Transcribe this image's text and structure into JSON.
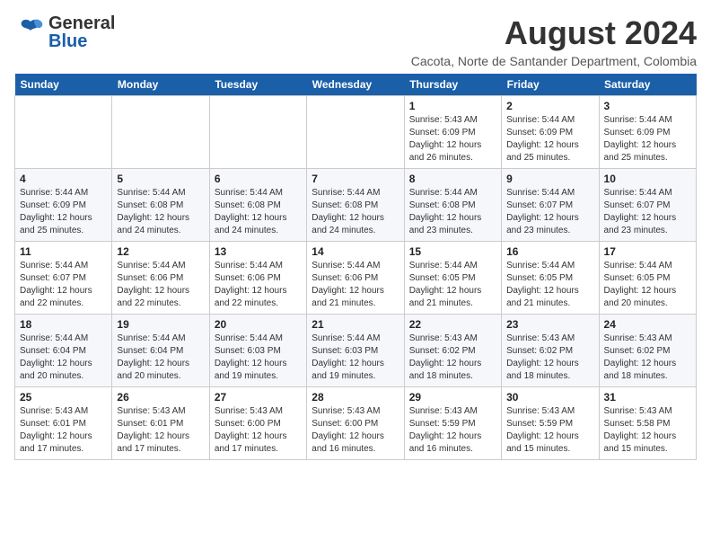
{
  "header": {
    "logo_general": "General",
    "logo_blue": "Blue",
    "month": "August 2024",
    "location": "Cacota, Norte de Santander Department, Colombia"
  },
  "weekdays": [
    "Sunday",
    "Monday",
    "Tuesday",
    "Wednesday",
    "Thursday",
    "Friday",
    "Saturday"
  ],
  "weeks": [
    [
      {
        "day": "",
        "info": ""
      },
      {
        "day": "",
        "info": ""
      },
      {
        "day": "",
        "info": ""
      },
      {
        "day": "",
        "info": ""
      },
      {
        "day": "1",
        "info": "Sunrise: 5:43 AM\nSunset: 6:09 PM\nDaylight: 12 hours\nand 26 minutes."
      },
      {
        "day": "2",
        "info": "Sunrise: 5:44 AM\nSunset: 6:09 PM\nDaylight: 12 hours\nand 25 minutes."
      },
      {
        "day": "3",
        "info": "Sunrise: 5:44 AM\nSunset: 6:09 PM\nDaylight: 12 hours\nand 25 minutes."
      }
    ],
    [
      {
        "day": "4",
        "info": "Sunrise: 5:44 AM\nSunset: 6:09 PM\nDaylight: 12 hours\nand 25 minutes."
      },
      {
        "day": "5",
        "info": "Sunrise: 5:44 AM\nSunset: 6:08 PM\nDaylight: 12 hours\nand 24 minutes."
      },
      {
        "day": "6",
        "info": "Sunrise: 5:44 AM\nSunset: 6:08 PM\nDaylight: 12 hours\nand 24 minutes."
      },
      {
        "day": "7",
        "info": "Sunrise: 5:44 AM\nSunset: 6:08 PM\nDaylight: 12 hours\nand 24 minutes."
      },
      {
        "day": "8",
        "info": "Sunrise: 5:44 AM\nSunset: 6:08 PM\nDaylight: 12 hours\nand 23 minutes."
      },
      {
        "day": "9",
        "info": "Sunrise: 5:44 AM\nSunset: 6:07 PM\nDaylight: 12 hours\nand 23 minutes."
      },
      {
        "day": "10",
        "info": "Sunrise: 5:44 AM\nSunset: 6:07 PM\nDaylight: 12 hours\nand 23 minutes."
      }
    ],
    [
      {
        "day": "11",
        "info": "Sunrise: 5:44 AM\nSunset: 6:07 PM\nDaylight: 12 hours\nand 22 minutes."
      },
      {
        "day": "12",
        "info": "Sunrise: 5:44 AM\nSunset: 6:06 PM\nDaylight: 12 hours\nand 22 minutes."
      },
      {
        "day": "13",
        "info": "Sunrise: 5:44 AM\nSunset: 6:06 PM\nDaylight: 12 hours\nand 22 minutes."
      },
      {
        "day": "14",
        "info": "Sunrise: 5:44 AM\nSunset: 6:06 PM\nDaylight: 12 hours\nand 21 minutes."
      },
      {
        "day": "15",
        "info": "Sunrise: 5:44 AM\nSunset: 6:05 PM\nDaylight: 12 hours\nand 21 minutes."
      },
      {
        "day": "16",
        "info": "Sunrise: 5:44 AM\nSunset: 6:05 PM\nDaylight: 12 hours\nand 21 minutes."
      },
      {
        "day": "17",
        "info": "Sunrise: 5:44 AM\nSunset: 6:05 PM\nDaylight: 12 hours\nand 20 minutes."
      }
    ],
    [
      {
        "day": "18",
        "info": "Sunrise: 5:44 AM\nSunset: 6:04 PM\nDaylight: 12 hours\nand 20 minutes."
      },
      {
        "day": "19",
        "info": "Sunrise: 5:44 AM\nSunset: 6:04 PM\nDaylight: 12 hours\nand 20 minutes."
      },
      {
        "day": "20",
        "info": "Sunrise: 5:44 AM\nSunset: 6:03 PM\nDaylight: 12 hours\nand 19 minutes."
      },
      {
        "day": "21",
        "info": "Sunrise: 5:44 AM\nSunset: 6:03 PM\nDaylight: 12 hours\nand 19 minutes."
      },
      {
        "day": "22",
        "info": "Sunrise: 5:43 AM\nSunset: 6:02 PM\nDaylight: 12 hours\nand 18 minutes."
      },
      {
        "day": "23",
        "info": "Sunrise: 5:43 AM\nSunset: 6:02 PM\nDaylight: 12 hours\nand 18 minutes."
      },
      {
        "day": "24",
        "info": "Sunrise: 5:43 AM\nSunset: 6:02 PM\nDaylight: 12 hours\nand 18 minutes."
      }
    ],
    [
      {
        "day": "25",
        "info": "Sunrise: 5:43 AM\nSunset: 6:01 PM\nDaylight: 12 hours\nand 17 minutes."
      },
      {
        "day": "26",
        "info": "Sunrise: 5:43 AM\nSunset: 6:01 PM\nDaylight: 12 hours\nand 17 minutes."
      },
      {
        "day": "27",
        "info": "Sunrise: 5:43 AM\nSunset: 6:00 PM\nDaylight: 12 hours\nand 17 minutes."
      },
      {
        "day": "28",
        "info": "Sunrise: 5:43 AM\nSunset: 6:00 PM\nDaylight: 12 hours\nand 16 minutes."
      },
      {
        "day": "29",
        "info": "Sunrise: 5:43 AM\nSunset: 5:59 PM\nDaylight: 12 hours\nand 16 minutes."
      },
      {
        "day": "30",
        "info": "Sunrise: 5:43 AM\nSunset: 5:59 PM\nDaylight: 12 hours\nand 15 minutes."
      },
      {
        "day": "31",
        "info": "Sunrise: 5:43 AM\nSunset: 5:58 PM\nDaylight: 12 hours\nand 15 minutes."
      }
    ]
  ]
}
